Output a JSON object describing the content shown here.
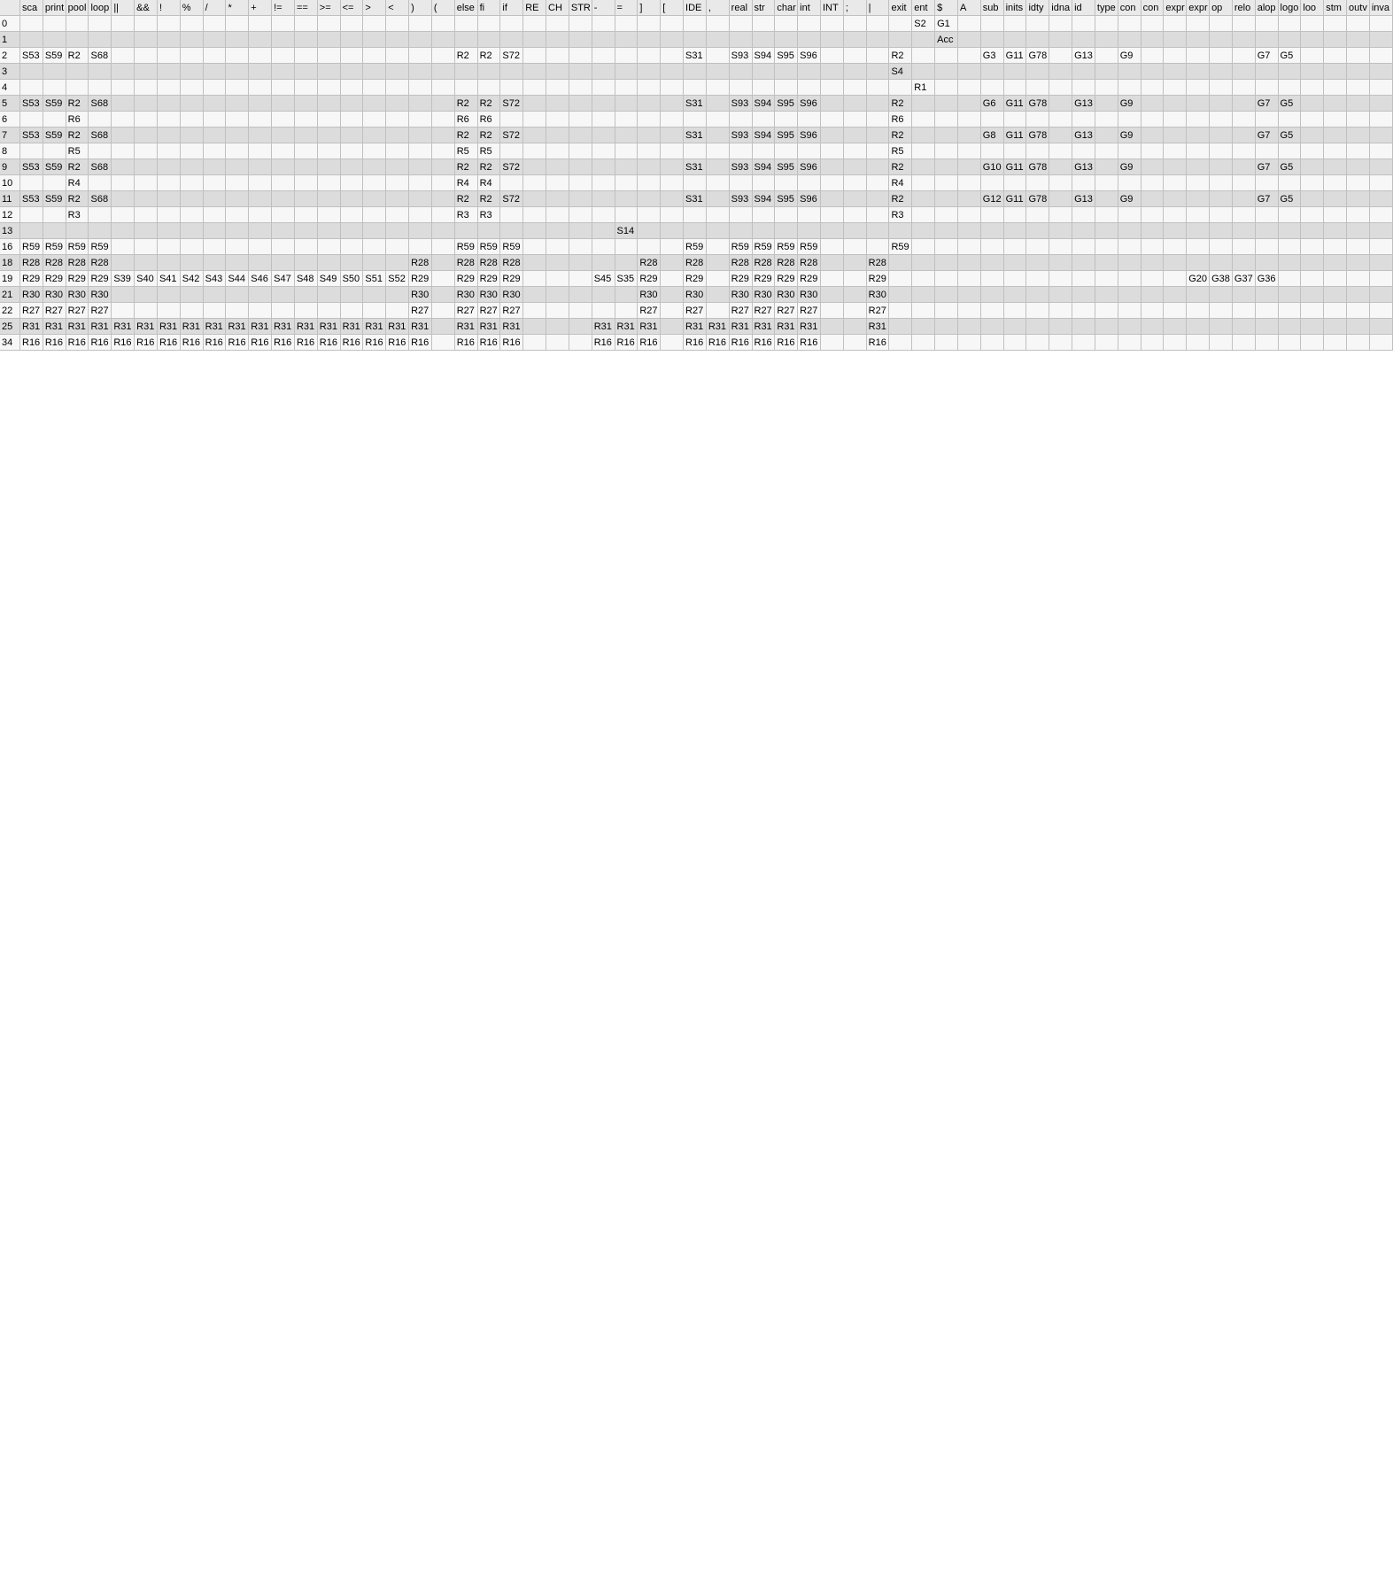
{
  "headers": [
    "",
    "sca",
    "print",
    "pool",
    "loop",
    "||",
    "&&",
    "!",
    "%",
    "/",
    "*",
    "+",
    "!=",
    "==",
    ">=",
    "<=",
    ">",
    "<",
    ")",
    "(",
    "else",
    "fi",
    "if",
    "RE",
    "CH",
    "STR",
    "-",
    "=",
    "]",
    "[",
    "IDE",
    ",",
    "real",
    "str",
    "char",
    "int",
    "INT",
    ";",
    "|",
    "exit",
    "ent",
    "$",
    "A",
    "sub",
    "inits",
    "idty",
    "idna",
    "id",
    "type",
    "con",
    "con",
    "expr",
    "expr",
    "op",
    "relo",
    "alop",
    "logo",
    "loo",
    "stm",
    "outv",
    "inva"
  ],
  "rows": [
    {
      "label": "0",
      "cells": [
        "",
        "",
        "",
        "",
        "",
        "",
        "",
        "",
        "",
        "",
        "",
        "",
        "",
        "",
        "",
        "",
        "",
        "",
        "",
        "",
        "",
        "",
        "",
        "",
        "",
        "",
        "",
        "",
        "",
        "",
        "",
        "",
        "",
        "",
        "",
        "",
        "",
        "",
        "",
        "S2",
        "G1"
      ]
    },
    {
      "label": "1",
      "cells": [
        "",
        "",
        "",
        "",
        "",
        "",
        "",
        "",
        "",
        "",
        "",
        "",
        "",
        "",
        "",
        "",
        "",
        "",
        "",
        "",
        "",
        "",
        "",
        "",
        "",
        "",
        "",
        "",
        "",
        "",
        "",
        "",
        "",
        "",
        "",
        "",
        "",
        "",
        "",
        "",
        "Acc"
      ]
    },
    {
      "label": "2",
      "cells": [
        "S53",
        "S59",
        "R2",
        "S68",
        "",
        "",
        "",
        "",
        "",
        "",
        "",
        "",
        "",
        "",
        "",
        "",
        "",
        "",
        "",
        "R2",
        "R2",
        "S72",
        "",
        "",
        "",
        "",
        "",
        "",
        "",
        "S31",
        "",
        "S93",
        "S94",
        "S95",
        "S96",
        "",
        "",
        "",
        "R2",
        "",
        "",
        "",
        "G3",
        "G11",
        "G78",
        "",
        "G13",
        "",
        "G9",
        "",
        "",
        "",
        "",
        "",
        "G7",
        "G5"
      ]
    },
    {
      "label": "3",
      "cells": [
        "",
        "",
        "",
        "",
        "",
        "",
        "",
        "",
        "",
        "",
        "",
        "",
        "",
        "",
        "",
        "",
        "",
        "",
        "",
        "",
        "",
        "",
        "",
        "",
        "",
        "",
        "",
        "",
        "",
        "",
        "",
        "",
        "",
        "",
        "",
        "",
        "",
        "",
        "S4"
      ]
    },
    {
      "label": "4",
      "cells": [
        "",
        "",
        "",
        "",
        "",
        "",
        "",
        "",
        "",
        "",
        "",
        "",
        "",
        "",
        "",
        "",
        "",
        "",
        "",
        "",
        "",
        "",
        "",
        "",
        "",
        "",
        "",
        "",
        "",
        "",
        "",
        "",
        "",
        "",
        "",
        "",
        "",
        "",
        "",
        "R1"
      ]
    },
    {
      "label": "5",
      "cells": [
        "S53",
        "S59",
        "R2",
        "S68",
        "",
        "",
        "",
        "",
        "",
        "",
        "",
        "",
        "",
        "",
        "",
        "",
        "",
        "",
        "",
        "R2",
        "R2",
        "S72",
        "",
        "",
        "",
        "",
        "",
        "",
        "",
        "S31",
        "",
        "S93",
        "S94",
        "S95",
        "S96",
        "",
        "",
        "",
        "R2",
        "",
        "",
        "",
        "G6",
        "G11",
        "G78",
        "",
        "G13",
        "",
        "G9",
        "",
        "",
        "",
        "",
        "",
        "G7",
        "G5"
      ]
    },
    {
      "label": "6",
      "cells": [
        "",
        "",
        "R6",
        "",
        "",
        "",
        "",
        "",
        "",
        "",
        "",
        "",
        "",
        "",
        "",
        "",
        "",
        "",
        "",
        "R6",
        "R6",
        "",
        "",
        "",
        "",
        "",
        "",
        "",
        "",
        "",
        "",
        "",
        "",
        "",
        "",
        "",
        "",
        "",
        "R6"
      ]
    },
    {
      "label": "7",
      "cells": [
        "S53",
        "S59",
        "R2",
        "S68",
        "",
        "",
        "",
        "",
        "",
        "",
        "",
        "",
        "",
        "",
        "",
        "",
        "",
        "",
        "",
        "R2",
        "R2",
        "S72",
        "",
        "",
        "",
        "",
        "",
        "",
        "",
        "S31",
        "",
        "S93",
        "S94",
        "S95",
        "S96",
        "",
        "",
        "",
        "R2",
        "",
        "",
        "",
        "G8",
        "G11",
        "G78",
        "",
        "G13",
        "",
        "G9",
        "",
        "",
        "",
        "",
        "",
        "G7",
        "G5"
      ]
    },
    {
      "label": "8",
      "cells": [
        "",
        "",
        "R5",
        "",
        "",
        "",
        "",
        "",
        "",
        "",
        "",
        "",
        "",
        "",
        "",
        "",
        "",
        "",
        "",
        "R5",
        "R5",
        "",
        "",
        "",
        "",
        "",
        "",
        "",
        "",
        "",
        "",
        "",
        "",
        "",
        "",
        "",
        "",
        "",
        "R5"
      ]
    },
    {
      "label": "9",
      "cells": [
        "S53",
        "S59",
        "R2",
        "S68",
        "",
        "",
        "",
        "",
        "",
        "",
        "",
        "",
        "",
        "",
        "",
        "",
        "",
        "",
        "",
        "R2",
        "R2",
        "S72",
        "",
        "",
        "",
        "",
        "",
        "",
        "",
        "S31",
        "",
        "S93",
        "S94",
        "S95",
        "S96",
        "",
        "",
        "",
        "R2",
        "",
        "",
        "",
        "G10",
        "G11",
        "G78",
        "",
        "G13",
        "",
        "G9",
        "",
        "",
        "",
        "",
        "",
        "G7",
        "G5"
      ]
    },
    {
      "label": "10",
      "cells": [
        "",
        "",
        "R4",
        "",
        "",
        "",
        "",
        "",
        "",
        "",
        "",
        "",
        "",
        "",
        "",
        "",
        "",
        "",
        "",
        "R4",
        "R4",
        "",
        "",
        "",
        "",
        "",
        "",
        "",
        "",
        "",
        "",
        "",
        "",
        "",
        "",
        "",
        "",
        "",
        "R4"
      ]
    },
    {
      "label": "11",
      "cells": [
        "S53",
        "S59",
        "R2",
        "S68",
        "",
        "",
        "",
        "",
        "",
        "",
        "",
        "",
        "",
        "",
        "",
        "",
        "",
        "",
        "",
        "R2",
        "R2",
        "S72",
        "",
        "",
        "",
        "",
        "",
        "",
        "",
        "S31",
        "",
        "S93",
        "S94",
        "S95",
        "S96",
        "",
        "",
        "",
        "R2",
        "",
        "",
        "",
        "G12",
        "G11",
        "G78",
        "",
        "G13",
        "",
        "G9",
        "",
        "",
        "",
        "",
        "",
        "G7",
        "G5"
      ]
    },
    {
      "label": "12",
      "cells": [
        "",
        "",
        "R3",
        "",
        "",
        "",
        "",
        "",
        "",
        "",
        "",
        "",
        "",
        "",
        "",
        "",
        "",
        "",
        "",
        "R3",
        "R3",
        "",
        "",
        "",
        "",
        "",
        "",
        "",
        "",
        "",
        "",
        "",
        "",
        "",
        "",
        "",
        "",
        "",
        "R3"
      ]
    },
    {
      "label": "13",
      "cells": [
        "",
        "",
        "",
        "",
        "",
        "",
        "",
        "",
        "",
        "",
        "",
        "",
        "",
        "",
        "",
        "",
        "",
        "",
        "",
        "",
        "",
        "",
        "",
        "",
        "",
        "",
        "S14"
      ]
    },
    {
      "label": "16",
      "cells": [
        "R59",
        "R59",
        "R59",
        "R59",
        "",
        "",
        "",
        "",
        "",
        "",
        "",
        "",
        "",
        "",
        "",
        "",
        "",
        "",
        "",
        "R59",
        "R59",
        "R59",
        "",
        "",
        "",
        "",
        "",
        "",
        "",
        "R59",
        "",
        "R59",
        "R59",
        "R59",
        "R59",
        "",
        "",
        "",
        "R59"
      ]
    },
    {
      "label": "18",
      "cells": [
        "R28",
        "R28",
        "R28",
        "R28",
        "",
        "",
        "",
        "",
        "",
        "",
        "",
        "",
        "",
        "",
        "",
        "",
        "",
        "R28",
        "",
        "R28",
        "R28",
        "R28",
        "",
        "",
        "",
        "",
        "",
        "R28",
        "",
        "R28",
        "",
        "R28",
        "R28",
        "R28",
        "R28",
        "",
        "",
        "R28"
      ]
    },
    {
      "label": "19",
      "cells": [
        "R29",
        "R29",
        "R29",
        "R29",
        "S39",
        "S40",
        "S41",
        "S42",
        "S43",
        "S44",
        "S46",
        "S47",
        "S48",
        "S49",
        "S50",
        "S51",
        "S52",
        "R29",
        "",
        "R29",
        "R29",
        "R29",
        "",
        "",
        "",
        "S45",
        "S35",
        "R29",
        "",
        "R29",
        "",
        "R29",
        "R29",
        "R29",
        "R29",
        "",
        "",
        "R29",
        "",
        "",
        "",
        "",
        "",
        "",
        "",
        "",
        "",
        "",
        "",
        "",
        "",
        "G20",
        "G38",
        "G37",
        "G36"
      ]
    },
    {
      "label": "21",
      "cells": [
        "R30",
        "R30",
        "R30",
        "R30",
        "",
        "",
        "",
        "",
        "",
        "",
        "",
        "",
        "",
        "",
        "",
        "",
        "",
        "R30",
        "",
        "R30",
        "R30",
        "R30",
        "",
        "",
        "",
        "",
        "",
        "R30",
        "",
        "R30",
        "",
        "R30",
        "R30",
        "R30",
        "R30",
        "",
        "",
        "R30"
      ]
    },
    {
      "label": "22",
      "cells": [
        "R27",
        "R27",
        "R27",
        "R27",
        "",
        "",
        "",
        "",
        "",
        "",
        "",
        "",
        "",
        "",
        "",
        "",
        "",
        "R27",
        "",
        "R27",
        "R27",
        "R27",
        "",
        "",
        "",
        "",
        "",
        "R27",
        "",
        "R27",
        "",
        "R27",
        "R27",
        "R27",
        "R27",
        "",
        "",
        "R27"
      ]
    },
    {
      "label": "25",
      "cells": [
        "R31",
        "R31",
        "R31",
        "R31",
        "R31",
        "R31",
        "R31",
        "R31",
        "R31",
        "R31",
        "R31",
        "R31",
        "R31",
        "R31",
        "R31",
        "R31",
        "R31",
        "R31",
        "",
        "R31",
        "R31",
        "R31",
        "",
        "",
        "",
        "R31",
        "R31",
        "R31",
        "",
        "R31",
        "R31",
        "R31",
        "R31",
        "R31",
        "R31",
        "",
        "",
        "R31"
      ]
    },
    {
      "label": "34",
      "cells": [
        "R16",
        "R16",
        "R16",
        "R16",
        "R16",
        "R16",
        "R16",
        "R16",
        "R16",
        "R16",
        "R16",
        "R16",
        "R16",
        "R16",
        "R16",
        "R16",
        "R16",
        "R16",
        "",
        "R16",
        "R16",
        "R16",
        "",
        "",
        "",
        "R16",
        "R16",
        "R16",
        "",
        "R16",
        "R16",
        "R16",
        "R16",
        "R16",
        "R16",
        "",
        "",
        "R16"
      ]
    }
  ]
}
